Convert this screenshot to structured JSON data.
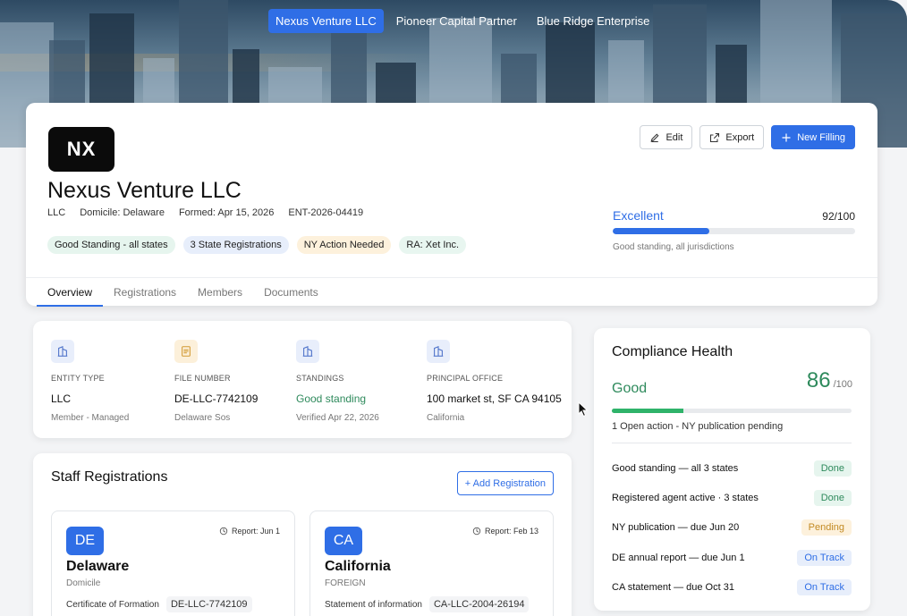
{
  "entities": [
    {
      "label": "Nexus Venture LLC",
      "active": true
    },
    {
      "label": "Pioneer Capital Partner",
      "active": false
    },
    {
      "label": "Blue Ridge Enterprise",
      "active": false
    }
  ],
  "header": {
    "logo_text": "NX",
    "name": "Nexus Venture LLC",
    "meta": [
      "LLC",
      "Domicile: Delaware",
      "Formed: Apr 15, 2026",
      "ENT-2026-04419"
    ],
    "chips": [
      {
        "label": "Good Standing - all states",
        "tone": "green"
      },
      {
        "label": "3 State Registrations",
        "tone": "blue"
      },
      {
        "label": "NY Action Needed",
        "tone": "amber"
      },
      {
        "label": "RA: Xet Inc.",
        "tone": "mint"
      }
    ],
    "actions": {
      "edit": "Edit",
      "export": "Export",
      "new_filing": "New Filling"
    },
    "score": {
      "label": "Excellent",
      "value": "92/100",
      "fraction": 0.4,
      "note": "Good standing, all jurisdictions"
    }
  },
  "tabs": [
    "Overview",
    "Registrations",
    "Members",
    "Documents"
  ],
  "info": [
    {
      "label": "ENTITY TYPE",
      "value": "LLC",
      "sub": "Member - Managed",
      "icon": "building-icon",
      "tone": "blue"
    },
    {
      "label": "FILE NUMBER",
      "value": "DE-LLC-7742109",
      "sub": "Delaware Sos",
      "icon": "document-icon",
      "tone": "amber"
    },
    {
      "label": "STANDINGS",
      "value": "Good standing",
      "sub": "Verified Apr 22, 2026",
      "icon": "building-icon",
      "tone": "blue"
    },
    {
      "label": "PRINCIPAL OFFICE",
      "value": "100 market st, SF CA 94105",
      "sub": "California",
      "icon": "building-icon",
      "tone": "blue"
    }
  ],
  "staff": {
    "title": "Staff Registrations",
    "add_label": "+ Add Registration",
    "cards": [
      {
        "code": "DE",
        "report": "Report: Jun 1",
        "name": "Delaware",
        "type": "Domicile",
        "row_label": "Certificate of Formation",
        "row_value": "DE-LLC-7742109"
      },
      {
        "code": "CA",
        "report": "Report: Feb 13",
        "name": "California",
        "type": "FOREIGN",
        "row_label": "Statement of information",
        "row_value": "CA-LLC-2004-26194"
      }
    ]
  },
  "health": {
    "title": "Compliance Health",
    "status": "Good",
    "score": "86",
    "max": "/100",
    "fraction": 0.3,
    "note": "1 Open action - NY publication pending",
    "items": [
      {
        "label": "Good standing — all 3 states",
        "status": "Done",
        "tone": "done"
      },
      {
        "label": "Registered agent active · 3 states",
        "status": "Done",
        "tone": "done"
      },
      {
        "label": "NY publication — due Jun 20",
        "status": "Pending",
        "tone": "pending"
      },
      {
        "label": "DE annual report — due Jun 1",
        "status": "On Track",
        "tone": "track"
      },
      {
        "label": "CA statement — due Oct 31",
        "status": "On Track",
        "tone": "track"
      }
    ]
  }
}
